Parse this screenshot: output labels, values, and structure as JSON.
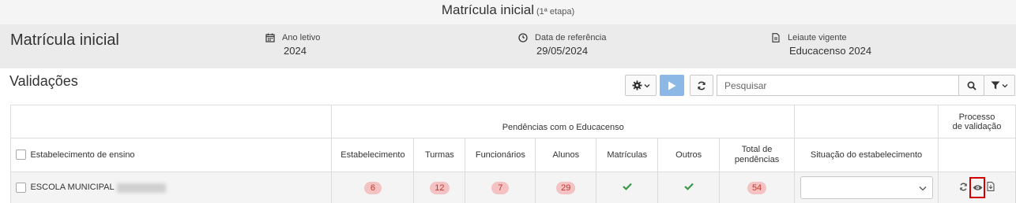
{
  "header": {
    "title": "Matrícula inicial",
    "subtitle": "(1ª etapa)"
  },
  "info": {
    "page_title": "Matrícula inicial",
    "ano_letivo_label": "Ano letivo",
    "ano_letivo_value": "2024",
    "data_ref_label": "Data de referência",
    "data_ref_value": "29/05/2024",
    "leiaute_label": "Leiaute vigente",
    "leiaute_value": "Educacenso 2024"
  },
  "section": {
    "title": "Validações"
  },
  "toolbar": {
    "search_placeholder": "Pesquisar"
  },
  "table": {
    "group_header": "Pendências com o Educacenso",
    "process_header_1": "Processo",
    "process_header_2": "de validação",
    "columns": {
      "estab_ensino": "Estabelecimento de ensino",
      "estabelecimento": "Estabelecimento",
      "turmas": "Turmas",
      "funcionarios": "Funcionários",
      "alunos": "Alunos",
      "matriculas": "Matrículas",
      "outros": "Outros",
      "total_1": "Total de",
      "total_2": "pendências",
      "situacao": "Situação do estabelecimento"
    },
    "rows": [
      {
        "name": "ESCOLA MUNICIPAL",
        "estabelecimento": "6",
        "turmas": "12",
        "funcionarios": "7",
        "alunos": "29",
        "matriculas": "check",
        "outros": "check",
        "total": "54",
        "situacao": ""
      }
    ]
  },
  "colors": {
    "accent": "#8cb8e6",
    "pill_bg": "#f4c2c2",
    "pill_text": "#c0392b",
    "check": "#3a9a48",
    "highlight": "#d40000"
  }
}
